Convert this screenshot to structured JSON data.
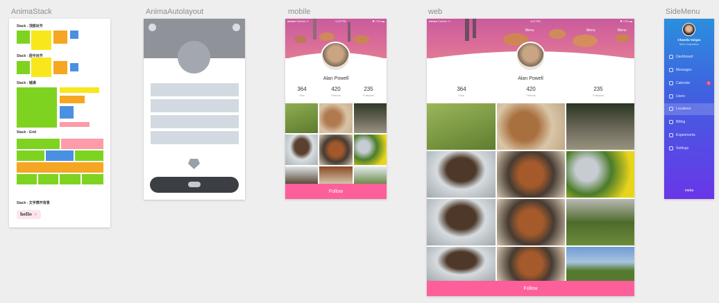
{
  "artboards": {
    "stack": "AnimaStack",
    "autolayout": "AnimaAutolayout",
    "mobile": "mobile",
    "web": "web",
    "sidemenu": "SideMenu"
  },
  "stack": {
    "label_top": "Stack - 顶部对齐",
    "label_center": "Stack - 居中对齐",
    "label_fill": "Stack - 铺满",
    "label_grid": "Stack - Grid",
    "label_text": "Stack - 文字撑开背景",
    "chip_text": "hello",
    "chip_close": "×"
  },
  "colors": {
    "green": "#7ed321",
    "yellow": "#f8e71c",
    "orange": "#f5a623",
    "blue": "#4a90e2",
    "pink": "#fd9ba8",
    "follow": "#fd5f9b"
  },
  "mobile": {
    "status_left": "●●●●● Carbon ᯤ",
    "status_time": "4:22 PM",
    "status_right": "✱ 71% ▬",
    "name": "Alan Powell",
    "stats": [
      {
        "n": "364",
        "l": "Pics"
      },
      {
        "n": "420",
        "l": "Friends"
      },
      {
        "n": "235",
        "l": "Follwoes"
      }
    ],
    "follow": "Follow"
  },
  "web": {
    "status_left": "●●●●● Carbon ᯤ",
    "status_time": "4:22 PM",
    "status_right": "✱ 71% ▬",
    "menus": [
      "Menu",
      "Menu",
      "Menu"
    ],
    "name": "Alan Powell",
    "stats": [
      {
        "n": "364",
        "l": "Pics"
      },
      {
        "n": "420",
        "l": "Friends"
      },
      {
        "n": "235",
        "l": "Follwoes"
      }
    ],
    "follow": "Follow"
  },
  "side": {
    "user_name": "Chavela Vargas",
    "user_org": "Mexo Corporation",
    "items": [
      "Dashboard",
      "Messages",
      "Calendar",
      "Users",
      "Locations",
      "Billing",
      "Experiments",
      "Settings"
    ],
    "badge": "3",
    "brand": "meka"
  }
}
